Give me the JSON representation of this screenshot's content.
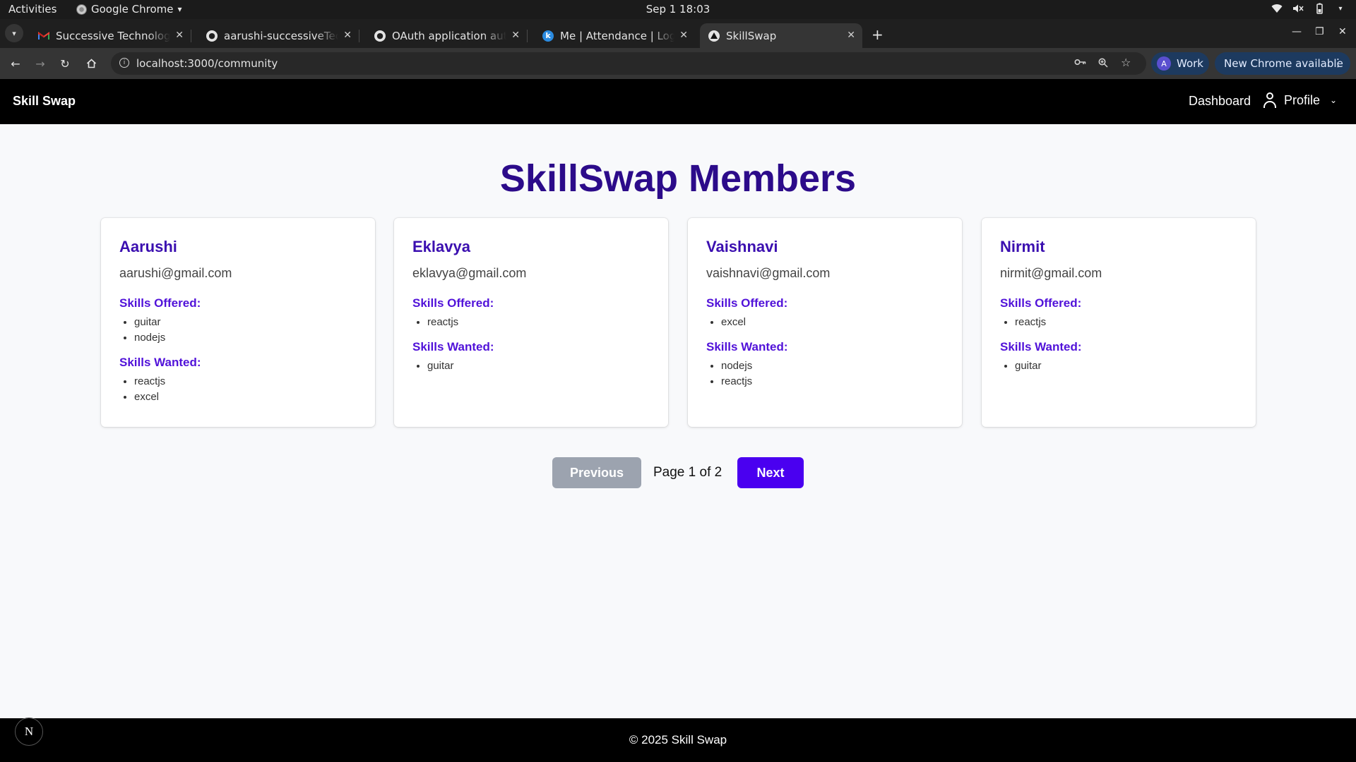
{
  "os": {
    "activities": "Activities",
    "app_name": "Google Chrome",
    "app_menu_arrow": "▾",
    "clock": "Sep 1  18:03"
  },
  "browser": {
    "tabs": [
      {
        "title": "Successive Technologies",
        "favicon": "gmail-icon"
      },
      {
        "title": "aarushi-successiveTech/s",
        "favicon": "github-icon"
      },
      {
        "title": "OAuth application autho",
        "favicon": "github-icon"
      },
      {
        "title": "Me | Attendance | Logs",
        "favicon": "keka-icon"
      },
      {
        "title": "SkillSwap",
        "favicon": "nextjs-icon"
      }
    ],
    "new_tab": "+",
    "url": "localhost:3000/community",
    "profile_chip": {
      "initial": "A",
      "label": "Work"
    },
    "update_chip": "New Chrome available"
  },
  "site": {
    "brand": "Skill Swap",
    "nav": {
      "dashboard": "Dashboard",
      "profile": "Profile"
    },
    "title": "SkillSwap Members",
    "offered_label": "Skills Offered:",
    "wanted_label": "Skills Wanted:",
    "members": [
      {
        "name": "Aarushi",
        "email": "aarushi@gmail.com",
        "offered": [
          "guitar",
          "nodejs"
        ],
        "wanted": [
          "reactjs",
          "excel"
        ]
      },
      {
        "name": "Eklavya",
        "email": "eklavya@gmail.com",
        "offered": [
          "reactjs"
        ],
        "wanted": [
          "guitar"
        ]
      },
      {
        "name": "Vaishnavi",
        "email": "vaishnavi@gmail.com",
        "offered": [
          "excel"
        ],
        "wanted": [
          "nodejs",
          "reactjs"
        ]
      },
      {
        "name": "Nirmit",
        "email": "nirmit@gmail.com",
        "offered": [
          "reactjs"
        ],
        "wanted": [
          "guitar"
        ]
      }
    ],
    "pagination": {
      "previous": "Previous",
      "label": "Page 1 of 2",
      "next": "Next"
    },
    "footer": "© 2025 Skill Swap",
    "dev_badge": "N"
  },
  "colors": {
    "title": "#2c0b8a",
    "member_name": "#3b0fb0",
    "section_label": "#5112d9",
    "next_button": "#4a00f0",
    "previous_button_disabled": "#9ca3af",
    "nav_bg": "#000000"
  }
}
